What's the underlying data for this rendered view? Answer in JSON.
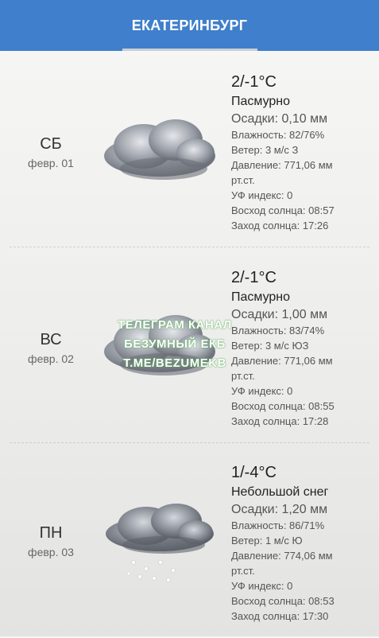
{
  "header": {
    "title": "ЕКАТЕРИНБУРГ"
  },
  "days": [
    {
      "dow": "СБ",
      "date": "февр. 01",
      "icon": "cloudy-icon",
      "temp": "2/-1°C",
      "condition": "Пасмурно",
      "precip": "Осадки: 0,10 мм",
      "humidity": "Влажность: 82/76%",
      "wind": "Ветер: 3 м/с З",
      "pressure_line1": "Давление: 771,06 мм",
      "pressure_line2": "рт.ст.",
      "uv": "УФ индекс: 0",
      "sunrise": "Восход солнца:  08:57",
      "sunset": "Заход солнца:  17:26"
    },
    {
      "dow": "ВС",
      "date": "февр. 02",
      "icon": "cloudy-icon",
      "temp": "2/-1°C",
      "condition": "Пасмурно",
      "precip": "Осадки: 1,00 мм",
      "humidity": "Влажность: 83/74%",
      "wind": "Ветер: 3 м/с ЮЗ",
      "pressure_line1": "Давление: 771,06 мм",
      "pressure_line2": "рт.ст.",
      "uv": "УФ индекс: 0",
      "sunrise": "Восход солнца:  08:55",
      "sunset": "Заход солнца:  17:28"
    },
    {
      "dow": "ПН",
      "date": "февр. 03",
      "icon": "light-snow-icon",
      "temp": "1/-4°C",
      "condition": "Небольшой снег",
      "precip": "Осадки: 1,20 мм",
      "humidity": "Влажность: 86/71%",
      "wind": "Ветер: 1 м/с Ю",
      "pressure_line1": "Давление: 774,06 мм",
      "pressure_line2": "рт.ст.",
      "uv": "УФ индекс: 0",
      "sunrise": "Восход солнца:  08:53",
      "sunset": "Заход солнца:  17:30"
    }
  ],
  "watermark": {
    "line1": "ТЕЛЕГРАМ КАНАЛ",
    "line2": "БЕЗУМНЫЙ ЕКБ",
    "line3": "T.ME/BEZUMEKB"
  },
  "colors": {
    "header_bg": "#3f7fcb",
    "header_text": "#ffffff"
  }
}
